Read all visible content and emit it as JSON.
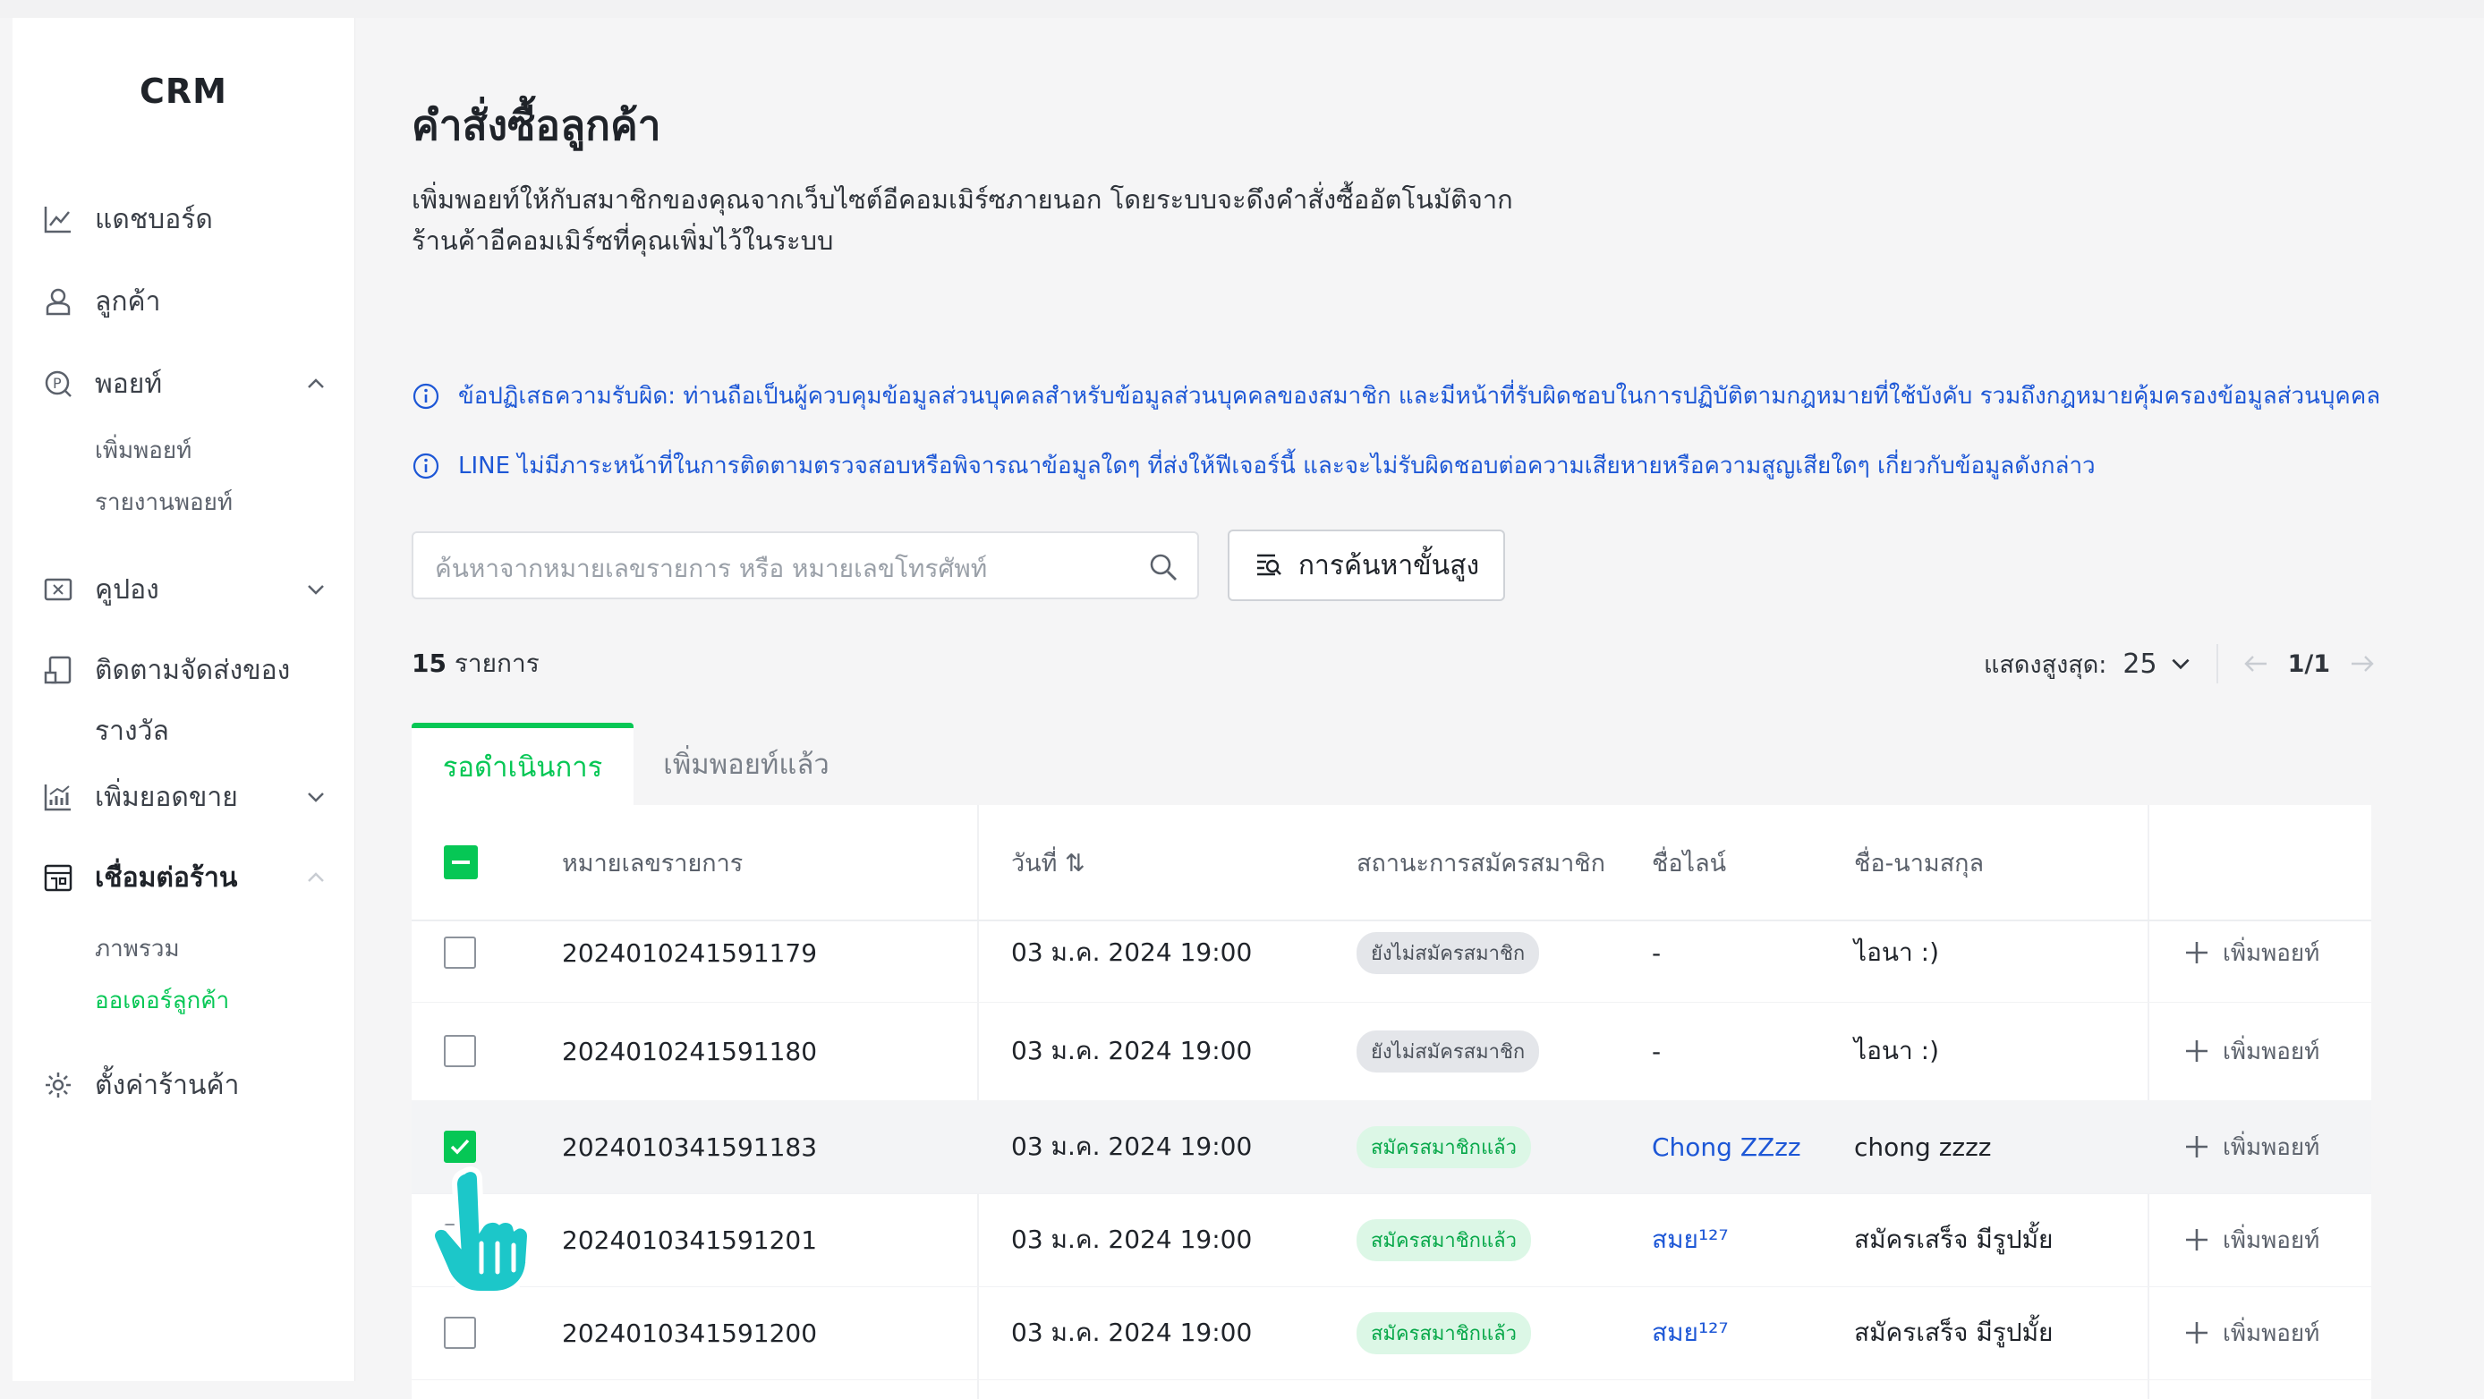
{
  "app": {
    "brand": "CRM"
  },
  "sidebar": {
    "items": [
      {
        "label": "แดชบอร์ด",
        "icon": "chart-line-icon"
      },
      {
        "label": "ลูกค้า",
        "icon": "user-icon"
      },
      {
        "label": "พอยท์",
        "icon": "points-icon",
        "expanded": true
      },
      {
        "label": "คูปอง",
        "icon": "coupon-icon",
        "expanded": false
      },
      {
        "label_line1": "ติดตามจัดส่งของ",
        "label_line2": "รางวัล",
        "icon": "reward-icon"
      },
      {
        "label": "เพิ่มยอดขาย",
        "icon": "growth-chart-icon",
        "expanded": false
      },
      {
        "label": "เชื่อมต่อร้าน",
        "icon": "store-icon",
        "expanded": true
      },
      {
        "label": "ตั้งค่าร้านค้า",
        "icon": "gear-icon"
      }
    ],
    "points_sub": [
      "เพิ่มพอยท์",
      "รายงานพอยท์"
    ],
    "store_sub": [
      "ภาพรวม",
      "ออเดอร์ลูกค้า"
    ]
  },
  "page": {
    "title": "คำสั่งซื้อลูกค้า",
    "desc_line1": "เพิ่มพอยท์ให้กับสมาชิกของคุณจากเว็บไซต์อีคอมเมิร์ซภายนอก โดยระบบจะดึงคำสั่งซื้ออัตโนมัติจาก",
    "desc_line2": "ร้านค้าอีคอมเมิร์ซที่คุณเพิ่มไว้ในระบบ",
    "notice1": "ข้อปฏิเสธความรับผิด: ท่านถือเป็นผู้ควบคุมข้อมูลส่วนบุคคลสำหรับข้อมูลส่วนบุคคลของสมาชิก และมีหน้าที่รับผิดชอบในการปฏิบัติตามกฎหมายที่ใช้บังคับ รวมถึงกฎหมายคุ้มครองข้อมูลส่วนบุคคล",
    "notice2": "LINE ไม่มีภาระหน้าที่ในการติดตามตรวจสอบหรือพิจารณาข้อมูลใดๆ ที่ส่งให้ฟีเจอร์นี้ และจะไม่รับผิดชอบต่อความเสียหายหรือความสูญเสียใดๆ เกี่ยวกับข้อมูลดังกล่าว"
  },
  "search": {
    "placeholder": "ค้นหาจากหมายเลขรายการ หรือ หมายเลขโทรศัพท์",
    "advanced_label": "การค้นหาขั้นสูง"
  },
  "list": {
    "count": "15",
    "count_unit": "รายการ",
    "page_size_label": "แสดงสูงสุด:",
    "page_size": "25",
    "page": "1/1"
  },
  "tabs": [
    {
      "label": "รอดำเนินการ",
      "active": true
    },
    {
      "label": "เพิ่มพอยท์แล้ว",
      "active": false
    }
  ],
  "table": {
    "headers": {
      "order_no": "หมายเลขรายการ",
      "date": "วันที่ ⇅",
      "status": "สถานะการสมัครสมาชิก",
      "line_name": "ชื่อไลน์",
      "full_name": "ชื่อ-นามสกุล"
    },
    "add_points_label": "เพิ่มพอยท์",
    "rows": [
      {
        "order_no": "2024010241591179",
        "date": "03 ม.ค. 2024 19:00",
        "status": "ยังไม่สมัครสมาชิก",
        "line_name": "-",
        "full_name": "ไอนา :)",
        "checked": false
      },
      {
        "order_no": "2024010241591180",
        "date": "03 ม.ค. 2024 19:00",
        "status": "ยังไม่สมัครสมาชิก",
        "line_name": "-",
        "full_name": "ไอนา :)",
        "checked": false
      },
      {
        "order_no": "2024010341591183",
        "date": "03 ม.ค. 2024 19:00",
        "status": "สมัครสมาชิกแล้ว",
        "line_name": "Chong ZZzz",
        "full_name": "chong zzzz",
        "checked": true
      },
      {
        "order_no": "2024010341591201",
        "date": "03 ม.ค. 2024 19:00",
        "status": "สมัครสมาชิกแล้ว",
        "line_name": "สมย¹²⁷",
        "full_name": "สมัครเสร็จ มีรูปมั้ย",
        "checked": false
      },
      {
        "order_no": "2024010341591200",
        "date": "03 ม.ค. 2024 19:00",
        "status": "สมัครสมาชิกแล้ว",
        "line_name": "สมย¹²⁷",
        "full_name": "สมัครเสร็จ มีรูปมั้ย",
        "checked": false
      }
    ]
  },
  "colors": {
    "accent": "#06c755",
    "link": "#1d57d6",
    "hand": "#1cc7c9"
  }
}
